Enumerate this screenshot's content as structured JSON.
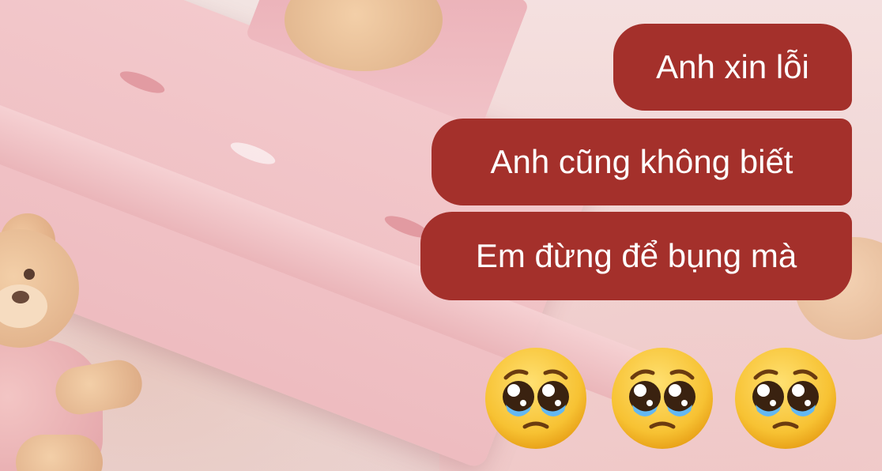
{
  "messages": [
    {
      "text": "Anh xin lỗi"
    },
    {
      "text": "Anh cũng không biết"
    },
    {
      "text": "Em đừng để bụng mà"
    }
  ],
  "emojis": [
    {
      "icon": "pleading-face-emoji"
    },
    {
      "icon": "pleading-face-emoji"
    },
    {
      "icon": "pleading-face-emoji"
    }
  ],
  "colors": {
    "bubble": "#a4302b",
    "bubble_text": "#ffffff",
    "background": "#efe0dc"
  }
}
